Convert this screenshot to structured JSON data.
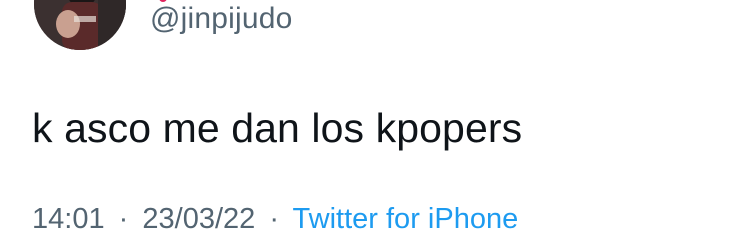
{
  "tweet": {
    "handle": "@jinpijudo",
    "text": "k asco me dan los kpopers",
    "time": "14:01",
    "date": "23/03/22",
    "separator": "·",
    "source": "Twitter for iPhone"
  },
  "colors": {
    "text_primary": "#0f1419",
    "text_secondary": "#536471",
    "link": "#1d9bf0",
    "background": "#ffffff"
  }
}
